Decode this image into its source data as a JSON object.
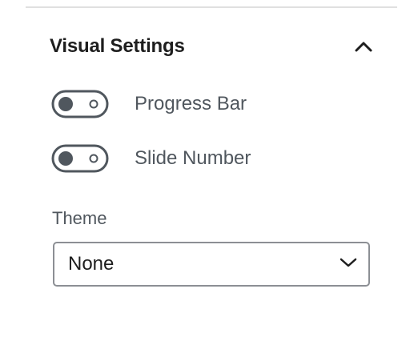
{
  "panel": {
    "title": "Visual Settings",
    "expanded": true,
    "toggles": [
      {
        "label": "Progress Bar",
        "checked": false
      },
      {
        "label": "Slide Number",
        "checked": false
      }
    ],
    "theme": {
      "label": "Theme",
      "selected": "None"
    }
  },
  "icons": {
    "collapse": "chevron-up-icon",
    "dropdown": "chevron-down-icon"
  },
  "colors": {
    "toggle_border": "#50575e",
    "text_muted": "#50575e",
    "text_primary": "#1e1e1e",
    "select_border": "#8c8f94",
    "divider": "#e0e0e0"
  }
}
